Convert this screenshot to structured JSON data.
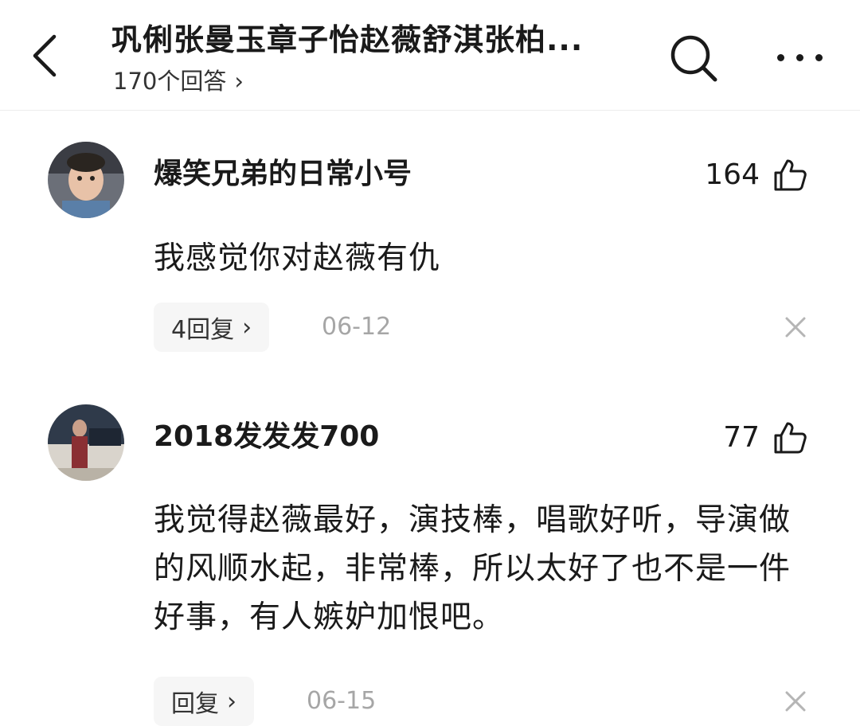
{
  "header": {
    "title": "巩俐张曼玉章子怡赵薇舒淇张柏...",
    "answer_count": "170个回答",
    "chevron": "›"
  },
  "icons": {
    "back": "back-arrow-icon",
    "search": "search-icon",
    "more": "more-dots-icon",
    "like": "thumbs-up-icon",
    "close": "close-icon"
  },
  "comments": [
    {
      "author": "爆笑兄弟的日常小号",
      "likes": "164",
      "text": "我感觉你对赵薇有仇",
      "reply_label": "4回复",
      "date": "06-12"
    },
    {
      "author": "2018发发发700",
      "likes": "77",
      "text": "我觉得赵薇最好，演技棒，唱歌好听，导演做的风顺水起，非常棒，所以太好了也不是一件好事，有人嫉妒加恨吧。",
      "reply_label": "回复",
      "date": "06-15"
    }
  ],
  "colors": {
    "text": "#1a1a1a",
    "muted": "#a6a6a6",
    "reply_bg": "#f6f6f6",
    "divider": "#ececec"
  }
}
